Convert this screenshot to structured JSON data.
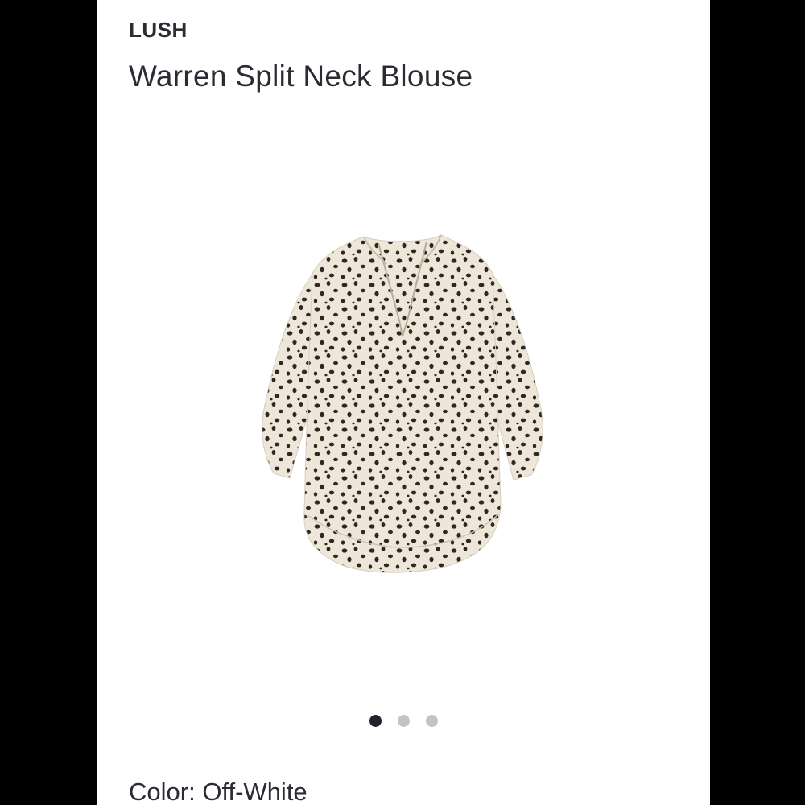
{
  "product": {
    "brand": "LUSH",
    "name": "Warren Split Neck Blouse",
    "image_alt": "Warren Split Neck Blouse",
    "color_label": "Color:",
    "color_value": "Off-White"
  },
  "carousel": {
    "count": 3,
    "active_index": 0
  },
  "colors": {
    "page_background": "#000000",
    "card_background": "#ffffff",
    "text": "#2b2b33",
    "dot_active": "#23232e",
    "dot_inactive": "#c4c4c8",
    "fabric": "#efe6da",
    "print_spots": "#2e2722"
  },
  "icons": [
    "blouse-product-image"
  ]
}
